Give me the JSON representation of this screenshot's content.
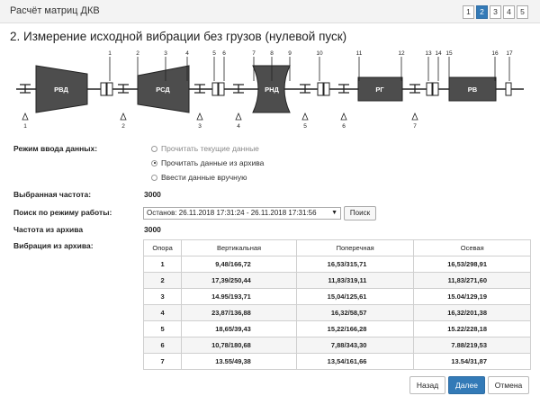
{
  "window": {
    "title": "Расчёт матриц ДКВ"
  },
  "pager": {
    "pages": [
      "1",
      "2",
      "3",
      "4",
      "5"
    ],
    "active": "2"
  },
  "heading": "2. Измерение исходной вибрации без грузов (нулевой пуск)",
  "scheme": {
    "components": [
      "РВД",
      "РСД",
      "РНД",
      "РГ",
      "РВ"
    ],
    "top_numbers": [
      "1",
      "2",
      "3",
      "4",
      "5",
      "6",
      "7",
      "8",
      "9",
      "10",
      "11",
      "12",
      "13",
      "14",
      "15",
      "16",
      "17"
    ],
    "bearings": [
      "1",
      "2",
      "3",
      "4",
      "5",
      "6",
      "7"
    ]
  },
  "form": {
    "input_mode_label": "Режим ввода данных:",
    "input_modes": [
      {
        "label": "Прочитать текущие данные",
        "selected": false
      },
      {
        "label": "Прочитать данные из архива",
        "selected": true
      },
      {
        "label": "Ввести данные вручную",
        "selected": false
      }
    ],
    "freq_label": "Выбранная частота:",
    "freq_value": "3000",
    "search_label": "Поиск по режиму работы:",
    "search_select": "Останов: 26.11.2018 17:31:24 - 26.11.2018 17:31:56",
    "search_button": "Поиск",
    "archive_freq_label": "Частота из архива",
    "archive_freq_value": "3000",
    "archive_vib_label": "Вибрация из архива:"
  },
  "table": {
    "headers": [
      "Опора",
      "Вертикальная",
      "Поперечная",
      "Осевая"
    ],
    "rows": [
      [
        "1",
        "9,48/166,72",
        "16,53/315,71",
        "16,53/298,91"
      ],
      [
        "2",
        "17,39/250,44",
        "11,83/319,11",
        "11,83/271,60"
      ],
      [
        "3",
        "14.95/193,71",
        "15,04/125,61",
        "15.04/129,19"
      ],
      [
        "4",
        "23,87/136,88",
        "16,32/58,57",
        "16,32/201,38"
      ],
      [
        "5",
        "18,65/39,43",
        "15,22/166,28",
        "15.22/228,18"
      ],
      [
        "6",
        "10,78/180,68",
        "7,88/343,30",
        "7.88/219,53"
      ],
      [
        "7",
        "13.55/49,38",
        "13,54/161,66",
        "13.54/31,87"
      ]
    ]
  },
  "buttons": {
    "back": "Назад",
    "next": "Далее",
    "cancel": "Отмена"
  }
}
